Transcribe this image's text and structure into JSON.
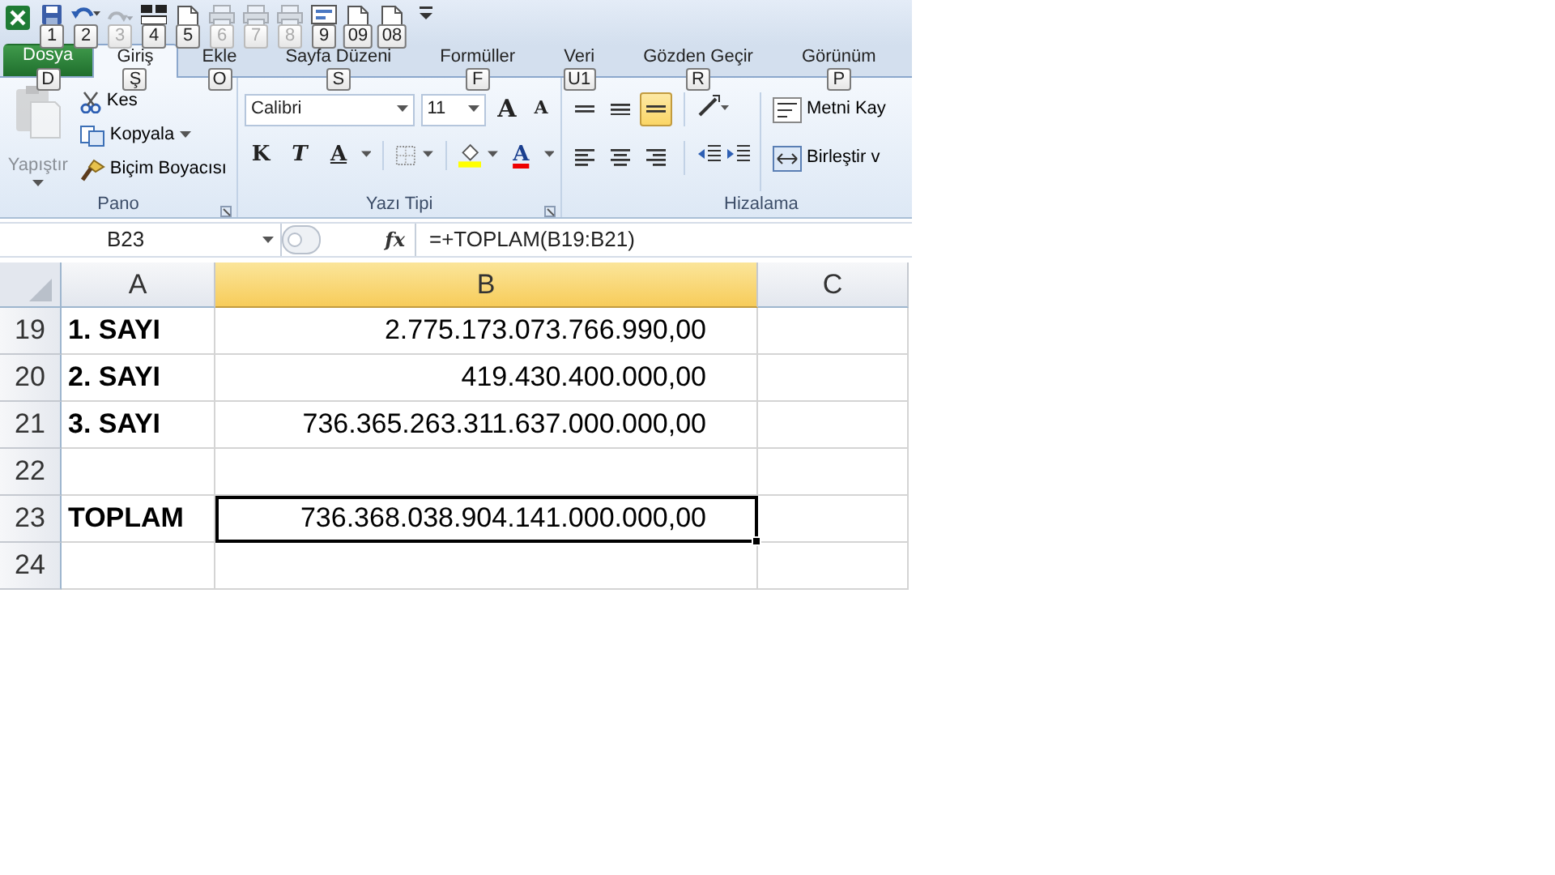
{
  "quick_access": [
    {
      "kind": "logo",
      "disabled": false
    },
    {
      "kind": "save",
      "keytip": "1",
      "disabled": false
    },
    {
      "kind": "undo",
      "keytip": "2",
      "disabled": false
    },
    {
      "kind": "redo",
      "keytip": "3",
      "disabled": true
    },
    {
      "kind": "table",
      "keytip": "4",
      "disabled": false
    },
    {
      "kind": "page",
      "keytip": "5",
      "disabled": false
    },
    {
      "kind": "print",
      "keytip": "6",
      "disabled": true
    },
    {
      "kind": "print",
      "keytip": "7",
      "disabled": true
    },
    {
      "kind": "print",
      "keytip": "8",
      "disabled": true
    },
    {
      "kind": "form",
      "keytip": "9",
      "disabled": false
    },
    {
      "kind": "page",
      "keytip": "09",
      "disabled": false
    },
    {
      "kind": "page",
      "keytip": "08",
      "disabled": false
    },
    {
      "kind": "customize",
      "disabled": false
    }
  ],
  "tabs": [
    {
      "label": "Dosya",
      "keytip": "D",
      "kind": "file",
      "selected": false
    },
    {
      "label": "Giriş",
      "keytip": "Ş",
      "kind": "tab",
      "selected": true
    },
    {
      "label": "Ekle",
      "keytip": "O",
      "kind": "tab",
      "selected": false
    },
    {
      "label": "Sayfa Düzeni",
      "keytip": "S",
      "kind": "tab",
      "selected": false
    },
    {
      "label": "Formüller",
      "keytip": "F",
      "kind": "tab",
      "selected": false
    },
    {
      "label": "Veri",
      "keytip": "U1",
      "kind": "tab",
      "selected": false
    },
    {
      "label": "Gözden Geçir",
      "keytip": "R",
      "kind": "tab",
      "selected": false
    },
    {
      "label": "Görünüm",
      "keytip": "P",
      "kind": "tab",
      "selected": false
    }
  ],
  "clipboard": {
    "title": "Pano",
    "paste": {
      "label": "Yapıştır",
      "disabled": true
    },
    "items": [
      {
        "label": "Kes",
        "kind": "cut"
      },
      {
        "label": "Kopyala",
        "kind": "copy"
      },
      {
        "label": "Biçim Boyacısı",
        "kind": "brush"
      }
    ]
  },
  "font": {
    "title": "Yazı Tipi",
    "name": "Calibri",
    "size": "11",
    "grow": "A",
    "shrink": "A",
    "bold": "K",
    "italic": "T",
    "underline": "A",
    "font_color": "A"
  },
  "alignment": {
    "title": "Hizalama",
    "top": [
      {
        "kind": "top",
        "selected": false
      },
      {
        "kind": "middle",
        "selected": false
      },
      {
        "kind": "bottom",
        "selected": true
      }
    ],
    "bottom": [
      {
        "kind": "left",
        "selected": false
      },
      {
        "kind": "center",
        "selected": false
      },
      {
        "kind": "right",
        "selected": false
      }
    ],
    "wrap": "Metni Kay",
    "merge": "Birleştir v"
  },
  "formula_bar": {
    "name_box": "B23",
    "fx": "fx",
    "formula": "=+TOPLAM(B19:B21)"
  },
  "columns": [
    {
      "label": "A",
      "selected": false
    },
    {
      "label": "B",
      "selected": true
    },
    {
      "label": "C",
      "selected": false
    }
  ],
  "rows": [
    {
      "number": "19",
      "cells": [
        {
          "text": "1. SAYI",
          "selected": false
        },
        {
          "text": "2.775.173.073.766.990,00",
          "selected": false
        }
      ]
    },
    {
      "number": "20",
      "cells": [
        {
          "text": "2. SAYI",
          "selected": false
        },
        {
          "text": "419.430.400.000,00",
          "selected": false
        }
      ]
    },
    {
      "number": "21",
      "cells": [
        {
          "text": "3. SAYI",
          "selected": false
        },
        {
          "text": "736.365.263.311.637.000.000,00",
          "selected": false
        }
      ]
    },
    {
      "number": "22"
    },
    {
      "number": "23",
      "cells": [
        {
          "text": "TOPLAM",
          "selected": false
        },
        {
          "text": "736.368.038.904.141.000.000,00",
          "selected": true
        }
      ]
    },
    {
      "number": "24"
    }
  ]
}
